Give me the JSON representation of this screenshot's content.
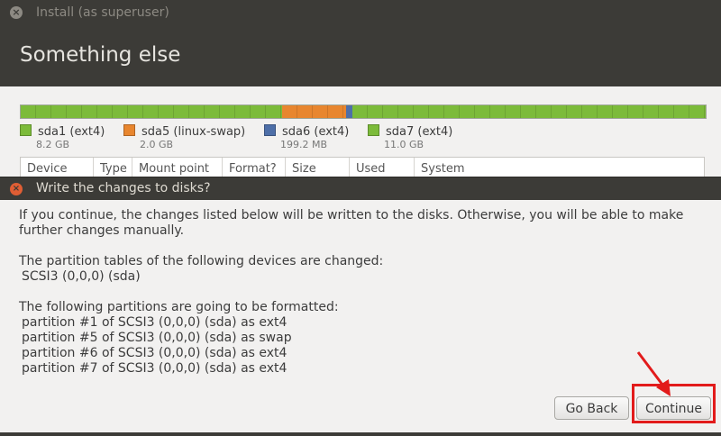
{
  "window": {
    "title": "Install (as superuser)"
  },
  "header": {
    "title": "Something else"
  },
  "partition_bar": {
    "segments": [
      {
        "name": "sda1",
        "color": "#7cbb3a",
        "fraction": 0.382
      },
      {
        "name": "sda5",
        "color": "#e8862f",
        "fraction": 0.093
      },
      {
        "name": "sda6",
        "color": "#4e6fa8",
        "fraction": 0.009
      },
      {
        "name": "sda7",
        "color": "#7cbb3a",
        "fraction": 0.516
      }
    ]
  },
  "legend": [
    {
      "label": "sda1 (ext4)",
      "size": "8.2 GB",
      "color": "#7cbb3a"
    },
    {
      "label": "sda5 (linux-swap)",
      "size": "2.0 GB",
      "color": "#e8862f"
    },
    {
      "label": "sda6 (ext4)",
      "size": "199.2 MB",
      "color": "#4e6fa8"
    },
    {
      "label": "sda7 (ext4)",
      "size": "11.0 GB",
      "color": "#7cbb3a"
    }
  ],
  "table": {
    "columns": [
      "Device",
      "Type",
      "Mount point",
      "Format?",
      "Size",
      "Used",
      "System"
    ]
  },
  "dialog": {
    "title": "Write the changes to disks?",
    "intro": "If you continue, the changes listed below will be written to the disks. Otherwise, you will be able to make further changes manually.",
    "tables_heading": "The partition tables of the following devices are changed:",
    "tables_device": "SCSI3 (0,0,0) (sda)",
    "format_heading": "The following partitions are going to be formatted:",
    "format_items": [
      "partition #1 of SCSI3 (0,0,0) (sda) as ext4",
      "partition #5 of SCSI3 (0,0,0) (sda) as swap",
      "partition #6 of SCSI3 (0,0,0) (sda) as ext4",
      "partition #7 of SCSI3 (0,0,0) (sda) as ext4"
    ],
    "buttons": {
      "back": "Go Back",
      "continue": "Continue"
    }
  },
  "colors": {
    "highlight": "#e21b1b",
    "dialog_close": "#e05e34"
  }
}
